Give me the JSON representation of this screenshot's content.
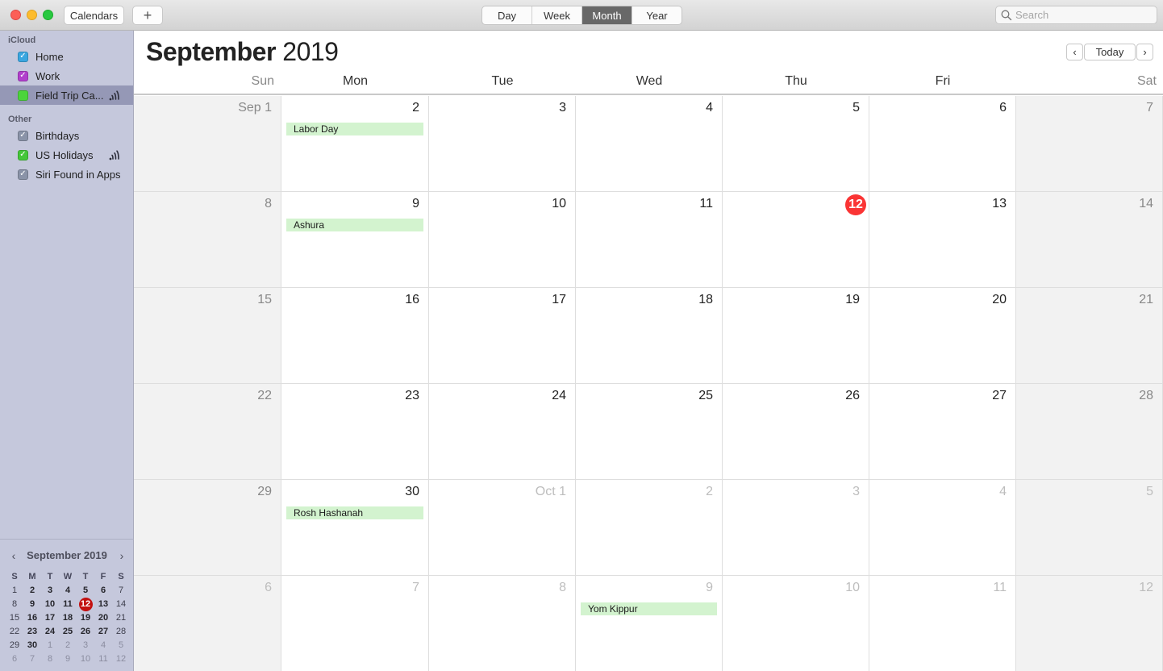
{
  "toolbar": {
    "calendars_label": "Calendars",
    "add_label": "+",
    "views": [
      {
        "label": "Day",
        "active": false
      },
      {
        "label": "Week",
        "active": false
      },
      {
        "label": "Month",
        "active": true
      },
      {
        "label": "Year",
        "active": false
      }
    ],
    "search": {
      "placeholder": "Search",
      "value": ""
    }
  },
  "sidebar": {
    "sections": [
      {
        "title": "iCloud",
        "items": [
          {
            "label": "Home",
            "color": "#3aa6e0",
            "checked": true,
            "selected": false,
            "shared": false
          },
          {
            "label": "Work",
            "color": "#b13fcc",
            "checked": true,
            "selected": false,
            "shared": false
          },
          {
            "label": "Field Trip Ca...",
            "color": "#4cd43c",
            "checked": false,
            "selected": true,
            "shared": true
          }
        ]
      },
      {
        "title": "Other",
        "items": [
          {
            "label": "Birthdays",
            "color": "#8a93a8",
            "checked": true,
            "selected": false,
            "shared": false
          },
          {
            "label": "US Holidays",
            "color": "#45c63a",
            "checked": true,
            "selected": false,
            "shared": true
          },
          {
            "label": "Siri Found in Apps",
            "color": "#8a93a8",
            "checked": true,
            "selected": false,
            "shared": false
          }
        ]
      }
    ],
    "mini_calendar": {
      "title": "September 2019",
      "weekday_headers": [
        "S",
        "M",
        "T",
        "W",
        "T",
        "F",
        "S"
      ],
      "weeks": [
        [
          "1",
          "2",
          "3",
          "4",
          "5",
          "6",
          "7"
        ],
        [
          "8",
          "9",
          "10",
          "11",
          "12",
          "13",
          "14"
        ],
        [
          "15",
          "16",
          "17",
          "18",
          "19",
          "20",
          "21"
        ],
        [
          "22",
          "23",
          "24",
          "25",
          "26",
          "27",
          "28"
        ],
        [
          "29",
          "30",
          "1",
          "2",
          "3",
          "4",
          "5"
        ],
        [
          "6",
          "7",
          "8",
          "9",
          "10",
          "11",
          "12"
        ]
      ],
      "today": "12"
    }
  },
  "main": {
    "title_month": "September",
    "title_year": "2019",
    "nav": {
      "prev": "‹",
      "today": "Today",
      "next": "›"
    },
    "weekdays": [
      "Sun",
      "Mon",
      "Tue",
      "Wed",
      "Thu",
      "Fri",
      "Sat"
    ],
    "weeks": [
      [
        {
          "label": "Sep 1"
        },
        {
          "label": "2",
          "events": [
            "Labor Day"
          ]
        },
        {
          "label": "3"
        },
        {
          "label": "4"
        },
        {
          "label": "5"
        },
        {
          "label": "6"
        },
        {
          "label": "7"
        }
      ],
      [
        {
          "label": "8"
        },
        {
          "label": "9",
          "events": [
            "Ashura"
          ]
        },
        {
          "label": "10"
        },
        {
          "label": "11"
        },
        {
          "label": "12",
          "today": true
        },
        {
          "label": "13"
        },
        {
          "label": "14"
        }
      ],
      [
        {
          "label": "15"
        },
        {
          "label": "16"
        },
        {
          "label": "17"
        },
        {
          "label": "18"
        },
        {
          "label": "19"
        },
        {
          "label": "20"
        },
        {
          "label": "21"
        }
      ],
      [
        {
          "label": "22"
        },
        {
          "label": "23"
        },
        {
          "label": "24"
        },
        {
          "label": "25"
        },
        {
          "label": "26"
        },
        {
          "label": "27"
        },
        {
          "label": "28"
        }
      ],
      [
        {
          "label": "29"
        },
        {
          "label": "30",
          "events": [
            "Rosh Hashanah"
          ]
        },
        {
          "label": "Oct 1",
          "other": true
        },
        {
          "label": "2",
          "other": true
        },
        {
          "label": "3",
          "other": true
        },
        {
          "label": "4",
          "other": true
        },
        {
          "label": "5",
          "other": true
        }
      ],
      [
        {
          "label": "6",
          "other": true
        },
        {
          "label": "7",
          "other": true
        },
        {
          "label": "8",
          "other": true
        },
        {
          "label": "9",
          "other": true,
          "events": [
            "Yom Kippur"
          ]
        },
        {
          "label": "10",
          "other": true
        },
        {
          "label": "11",
          "other": true
        },
        {
          "label": "12",
          "other": true
        }
      ]
    ]
  }
}
